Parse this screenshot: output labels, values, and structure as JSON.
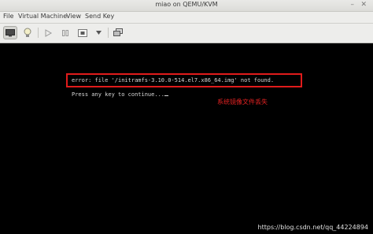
{
  "window": {
    "title": "miao on QEMU/KVM"
  },
  "menubar": {
    "items": [
      "File",
      "Virtual Machine",
      "View",
      "Send Key"
    ]
  },
  "toolbar": {
    "icons": [
      "monitor-icon",
      "lightbulb-icon",
      "play-icon",
      "pause-icon",
      "stop-icon",
      "dropdown-arrow-icon",
      "snapshot-icon"
    ]
  },
  "console": {
    "error_line": "error: file '/initramfs-3.10.0-514.el7.x86_64.img' not found.",
    "prompt_line": "Press any key to continue..."
  },
  "annotation": {
    "note": "系统镜像文件丢失",
    "color": "#e32222"
  },
  "watermark": "https://blog.csdn.net/qq_44224894"
}
